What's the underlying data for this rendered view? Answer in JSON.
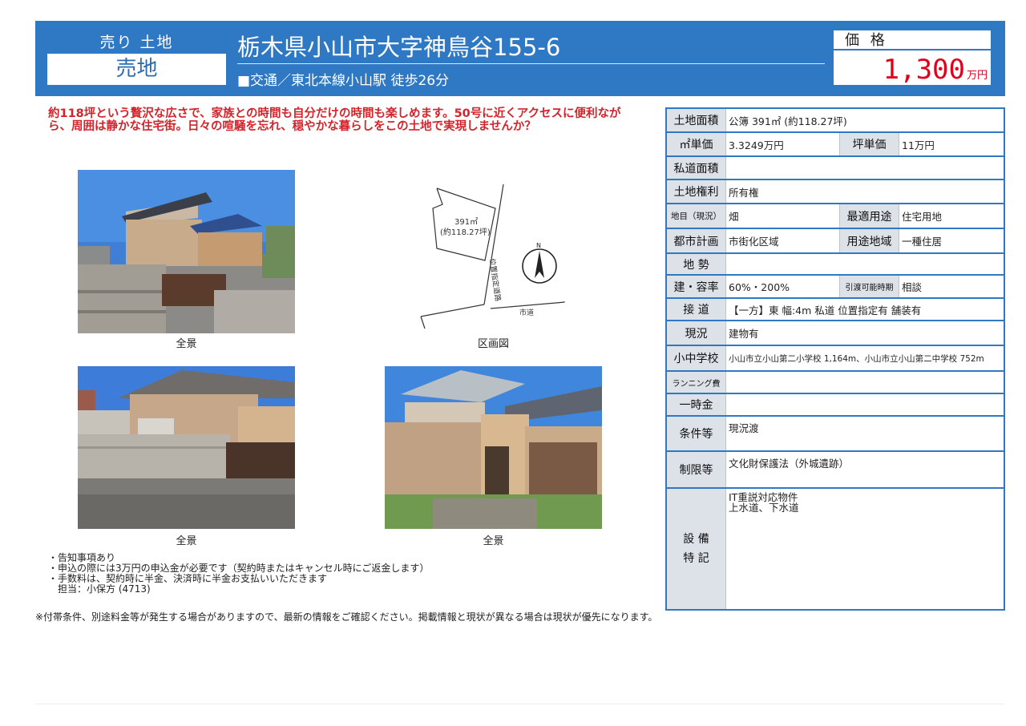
{
  "header": {
    "category": "売り 土地",
    "type": "売地",
    "address": "栃木県小山市大字神鳥谷155-6",
    "access": "■交通／東北本線小山駅 徒歩26分",
    "price_label": "価 格",
    "price": "1,300",
    "price_unit": "万円"
  },
  "description": "約118坪という贅沢な広さで、家族との時間も自分だけの時間も楽しめます。50号に近くアクセスに便利ながら、周囲は静かな住宅街。日々の喧騒を忘れ、穏やかな暮らしをこの土地で実現しませんか？",
  "photos": [
    {
      "caption": "全景"
    },
    {
      "caption": "区画図"
    },
    {
      "caption": "全景"
    },
    {
      "caption": "全景"
    }
  ],
  "plot_map": {
    "area_line1": "391㎡",
    "area_line2": "(約118.27坪)",
    "road_label": "位置指定道路",
    "city_road": "市道",
    "north": "N"
  },
  "notes": [
    "・告知事項あり",
    "・申込の際には3万円の申込金が必要です（契約時またはキャンセル時にご返金します）",
    "・手数料は、契約時に半金、決済時に半金お支払いいただきます",
    "　担当：小保方 (4713)"
  ],
  "footnote": "※付帯条件、別途料金等が発生する場合がありますので、最新の情報をご確認ください。掲載情報と現状が異なる場合は現状が優先になります。",
  "spec": {
    "land_area_label": "土地面積",
    "land_area": "公簿 391㎡ (約118.27坪)",
    "unit_price_label": "㎡単価",
    "unit_price": "3.3249万円",
    "tsubo_price_label": "坪単価",
    "tsubo_price": "11万円",
    "private_road_label": "私道面積",
    "private_road": "",
    "land_rights_label": "土地権利",
    "land_rights": "所有権",
    "land_category_label": "地目（現況）",
    "land_category": "畑",
    "best_use_label": "最適用途",
    "best_use": "住宅用地",
    "city_plan_label": "都市計画",
    "city_plan": "市街化区域",
    "zoning_label": "用途地域",
    "zoning": "一種住居",
    "terrain_label": "地 勢",
    "terrain": "",
    "coverage_label": "建・容率",
    "coverage": "60%・200%",
    "handover_label": "引渡可能時期",
    "handover": "相談",
    "road_access_label": "接 道",
    "road_access": "【一方】東 幅:4m 私道 位置指定有 舗装有",
    "status_label": "現況",
    "status": "建物有",
    "schools_label": "小中学校",
    "schools": "小山市立小山第二小学校 1,164m、小山市立小山第二中学校 752m",
    "running_cost_label": "ランニング費",
    "running_cost": "",
    "lump_sum_label": "一時金",
    "lump_sum": "",
    "conditions_label": "条件等",
    "conditions": "現況渡",
    "restrictions_label": "制限等",
    "restrictions": "文化財保護法（外城遺跡）",
    "facilities_label1": "設 備",
    "facilities_label2": "特 記",
    "facilities_line1": "IT重説対応物件",
    "facilities_line2": "上水道、下水道"
  },
  "colors": {
    "brand_blue": "#2f78c4",
    "price_red": "#e0001b",
    "label_gray": "#dde1e8"
  }
}
